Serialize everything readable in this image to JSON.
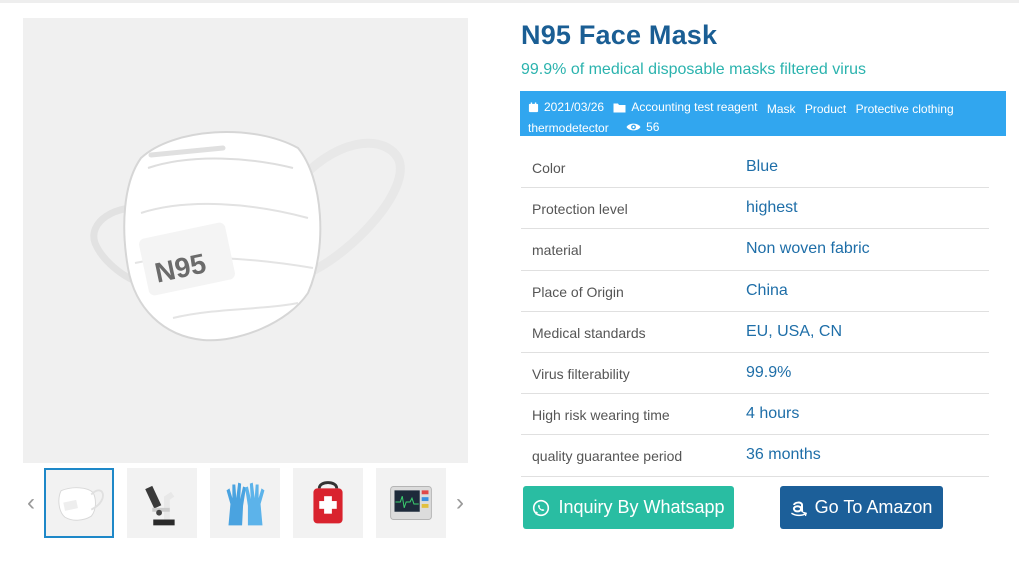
{
  "product": {
    "title": "N95 Face Mask",
    "subtitle": "99.9% of medical disposable masks filtered virus"
  },
  "meta": {
    "date": "2021/03/26",
    "tags": [
      "Accounting test reagent",
      "Mask",
      "Product",
      "Protective clothing",
      "thermodetector"
    ],
    "views": "56",
    "bar_color": "#31a6ef"
  },
  "gallery": {
    "main_image_label": "N95",
    "thumbnails": [
      {
        "name": "thumb-mask",
        "active": true
      },
      {
        "name": "thumb-microscope",
        "active": false
      },
      {
        "name": "thumb-gloves",
        "active": false
      },
      {
        "name": "thumb-first-aid-bag",
        "active": false
      },
      {
        "name": "thumb-patient-monitor",
        "active": false
      }
    ]
  },
  "specs": [
    {
      "label": "Color",
      "value": "Blue"
    },
    {
      "label": "Protection level",
      "value": "highest"
    },
    {
      "label": "material",
      "value": "Non woven fabric"
    },
    {
      "label": "Place of Origin",
      "value": "China"
    },
    {
      "label": "Medical standards",
      "value": "EU, USA, CN"
    },
    {
      "label": "Virus filterability",
      "value": "99.9%"
    },
    {
      "label": "High risk wearing time",
      "value": "4 hours"
    },
    {
      "label": "quality guarantee period",
      "value": "36 months"
    }
  ],
  "buttons": {
    "whatsapp": "Inquiry By Whatsapp",
    "amazon": "Go To Amazon",
    "whatsapp_color": "#29bda2",
    "amazon_color": "#1c5f99"
  }
}
